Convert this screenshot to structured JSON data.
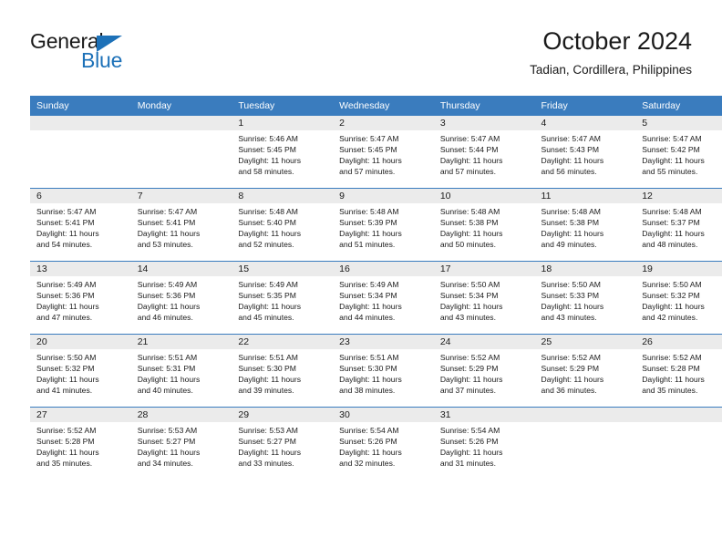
{
  "brand": {
    "name_top": "General",
    "name_bottom": "Blue",
    "triangle_color": "#1d71b8"
  },
  "header": {
    "title": "October 2024",
    "subtitle": "Tadian, Cordillera, Philippines"
  },
  "colors": {
    "header_blue": "#3a7cbe",
    "daynum_band": "#ebebeb",
    "text": "#1a1a1a"
  },
  "labels": {
    "sunrise_prefix": "Sunrise:",
    "sunset_prefix": "Sunset:",
    "daylight_prefix": "Daylight:"
  },
  "weekdays": [
    "Sunday",
    "Monday",
    "Tuesday",
    "Wednesday",
    "Thursday",
    "Friday",
    "Saturday"
  ],
  "weeks": [
    [
      {
        "day": "",
        "sunrise": "",
        "sunset": "",
        "daylight_line1": "",
        "daylight_line2": ""
      },
      {
        "day": "",
        "sunrise": "",
        "sunset": "",
        "daylight_line1": "",
        "daylight_line2": ""
      },
      {
        "day": "1",
        "sunrise": "Sunrise: 5:46 AM",
        "sunset": "Sunset: 5:45 PM",
        "daylight_line1": "Daylight: 11 hours",
        "daylight_line2": "and 58 minutes."
      },
      {
        "day": "2",
        "sunrise": "Sunrise: 5:47 AM",
        "sunset": "Sunset: 5:45 PM",
        "daylight_line1": "Daylight: 11 hours",
        "daylight_line2": "and 57 minutes."
      },
      {
        "day": "3",
        "sunrise": "Sunrise: 5:47 AM",
        "sunset": "Sunset: 5:44 PM",
        "daylight_line1": "Daylight: 11 hours",
        "daylight_line2": "and 57 minutes."
      },
      {
        "day": "4",
        "sunrise": "Sunrise: 5:47 AM",
        "sunset": "Sunset: 5:43 PM",
        "daylight_line1": "Daylight: 11 hours",
        "daylight_line2": "and 56 minutes."
      },
      {
        "day": "5",
        "sunrise": "Sunrise: 5:47 AM",
        "sunset": "Sunset: 5:42 PM",
        "daylight_line1": "Daylight: 11 hours",
        "daylight_line2": "and 55 minutes."
      }
    ],
    [
      {
        "day": "6",
        "sunrise": "Sunrise: 5:47 AM",
        "sunset": "Sunset: 5:41 PM",
        "daylight_line1": "Daylight: 11 hours",
        "daylight_line2": "and 54 minutes."
      },
      {
        "day": "7",
        "sunrise": "Sunrise: 5:47 AM",
        "sunset": "Sunset: 5:41 PM",
        "daylight_line1": "Daylight: 11 hours",
        "daylight_line2": "and 53 minutes."
      },
      {
        "day": "8",
        "sunrise": "Sunrise: 5:48 AM",
        "sunset": "Sunset: 5:40 PM",
        "daylight_line1": "Daylight: 11 hours",
        "daylight_line2": "and 52 minutes."
      },
      {
        "day": "9",
        "sunrise": "Sunrise: 5:48 AM",
        "sunset": "Sunset: 5:39 PM",
        "daylight_line1": "Daylight: 11 hours",
        "daylight_line2": "and 51 minutes."
      },
      {
        "day": "10",
        "sunrise": "Sunrise: 5:48 AM",
        "sunset": "Sunset: 5:38 PM",
        "daylight_line1": "Daylight: 11 hours",
        "daylight_line2": "and 50 minutes."
      },
      {
        "day": "11",
        "sunrise": "Sunrise: 5:48 AM",
        "sunset": "Sunset: 5:38 PM",
        "daylight_line1": "Daylight: 11 hours",
        "daylight_line2": "and 49 minutes."
      },
      {
        "day": "12",
        "sunrise": "Sunrise: 5:48 AM",
        "sunset": "Sunset: 5:37 PM",
        "daylight_line1": "Daylight: 11 hours",
        "daylight_line2": "and 48 minutes."
      }
    ],
    [
      {
        "day": "13",
        "sunrise": "Sunrise: 5:49 AM",
        "sunset": "Sunset: 5:36 PM",
        "daylight_line1": "Daylight: 11 hours",
        "daylight_line2": "and 47 minutes."
      },
      {
        "day": "14",
        "sunrise": "Sunrise: 5:49 AM",
        "sunset": "Sunset: 5:36 PM",
        "daylight_line1": "Daylight: 11 hours",
        "daylight_line2": "and 46 minutes."
      },
      {
        "day": "15",
        "sunrise": "Sunrise: 5:49 AM",
        "sunset": "Sunset: 5:35 PM",
        "daylight_line1": "Daylight: 11 hours",
        "daylight_line2": "and 45 minutes."
      },
      {
        "day": "16",
        "sunrise": "Sunrise: 5:49 AM",
        "sunset": "Sunset: 5:34 PM",
        "daylight_line1": "Daylight: 11 hours",
        "daylight_line2": "and 44 minutes."
      },
      {
        "day": "17",
        "sunrise": "Sunrise: 5:50 AM",
        "sunset": "Sunset: 5:34 PM",
        "daylight_line1": "Daylight: 11 hours",
        "daylight_line2": "and 43 minutes."
      },
      {
        "day": "18",
        "sunrise": "Sunrise: 5:50 AM",
        "sunset": "Sunset: 5:33 PM",
        "daylight_line1": "Daylight: 11 hours",
        "daylight_line2": "and 43 minutes."
      },
      {
        "day": "19",
        "sunrise": "Sunrise: 5:50 AM",
        "sunset": "Sunset: 5:32 PM",
        "daylight_line1": "Daylight: 11 hours",
        "daylight_line2": "and 42 minutes."
      }
    ],
    [
      {
        "day": "20",
        "sunrise": "Sunrise: 5:50 AM",
        "sunset": "Sunset: 5:32 PM",
        "daylight_line1": "Daylight: 11 hours",
        "daylight_line2": "and 41 minutes."
      },
      {
        "day": "21",
        "sunrise": "Sunrise: 5:51 AM",
        "sunset": "Sunset: 5:31 PM",
        "daylight_line1": "Daylight: 11 hours",
        "daylight_line2": "and 40 minutes."
      },
      {
        "day": "22",
        "sunrise": "Sunrise: 5:51 AM",
        "sunset": "Sunset: 5:30 PM",
        "daylight_line1": "Daylight: 11 hours",
        "daylight_line2": "and 39 minutes."
      },
      {
        "day": "23",
        "sunrise": "Sunrise: 5:51 AM",
        "sunset": "Sunset: 5:30 PM",
        "daylight_line1": "Daylight: 11 hours",
        "daylight_line2": "and 38 minutes."
      },
      {
        "day": "24",
        "sunrise": "Sunrise: 5:52 AM",
        "sunset": "Sunset: 5:29 PM",
        "daylight_line1": "Daylight: 11 hours",
        "daylight_line2": "and 37 minutes."
      },
      {
        "day": "25",
        "sunrise": "Sunrise: 5:52 AM",
        "sunset": "Sunset: 5:29 PM",
        "daylight_line1": "Daylight: 11 hours",
        "daylight_line2": "and 36 minutes."
      },
      {
        "day": "26",
        "sunrise": "Sunrise: 5:52 AM",
        "sunset": "Sunset: 5:28 PM",
        "daylight_line1": "Daylight: 11 hours",
        "daylight_line2": "and 35 minutes."
      }
    ],
    [
      {
        "day": "27",
        "sunrise": "Sunrise: 5:52 AM",
        "sunset": "Sunset: 5:28 PM",
        "daylight_line1": "Daylight: 11 hours",
        "daylight_line2": "and 35 minutes."
      },
      {
        "day": "28",
        "sunrise": "Sunrise: 5:53 AM",
        "sunset": "Sunset: 5:27 PM",
        "daylight_line1": "Daylight: 11 hours",
        "daylight_line2": "and 34 minutes."
      },
      {
        "day": "29",
        "sunrise": "Sunrise: 5:53 AM",
        "sunset": "Sunset: 5:27 PM",
        "daylight_line1": "Daylight: 11 hours",
        "daylight_line2": "and 33 minutes."
      },
      {
        "day": "30",
        "sunrise": "Sunrise: 5:54 AM",
        "sunset": "Sunset: 5:26 PM",
        "daylight_line1": "Daylight: 11 hours",
        "daylight_line2": "and 32 minutes."
      },
      {
        "day": "31",
        "sunrise": "Sunrise: 5:54 AM",
        "sunset": "Sunset: 5:26 PM",
        "daylight_line1": "Daylight: 11 hours",
        "daylight_line2": "and 31 minutes."
      },
      {
        "day": "",
        "sunrise": "",
        "sunset": "",
        "daylight_line1": "",
        "daylight_line2": ""
      },
      {
        "day": "",
        "sunrise": "",
        "sunset": "",
        "daylight_line1": "",
        "daylight_line2": ""
      }
    ]
  ]
}
